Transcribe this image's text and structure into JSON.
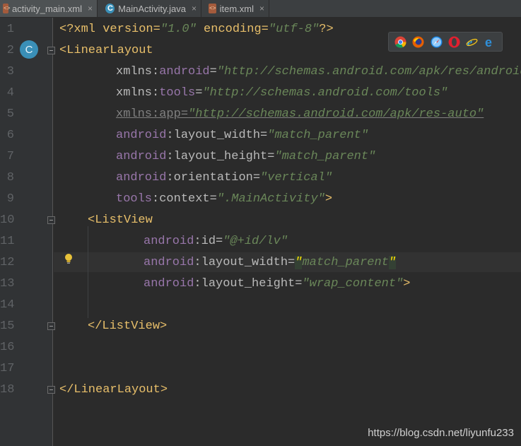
{
  "tabs": [
    {
      "label": "activity_main.xml",
      "icon": "xml-file-icon",
      "active": true
    },
    {
      "label": "MainActivity.java",
      "icon": "java-class-icon",
      "active": false
    },
    {
      "label": "item.xml",
      "icon": "xml-file-icon",
      "active": false
    }
  ],
  "close_glyph": "×",
  "badge": "C",
  "line_numbers": [
    "1",
    "2",
    "3",
    "4",
    "5",
    "6",
    "7",
    "8",
    "9",
    "10",
    "11",
    "12",
    "13",
    "14",
    "15",
    "16",
    "17",
    "18"
  ],
  "code": {
    "l1": {
      "open": "<?xml version=",
      "v1": "\"1.0\"",
      "mid": " encoding=",
      "v2": "\"utf-8\"",
      "close": "?>"
    },
    "l2": {
      "tag": "<LinearLayout"
    },
    "l3": {
      "attr": "xmlns:",
      "ns": "android",
      "eq": "=",
      "val": "\"http://schemas.android.com/apk/res/android\""
    },
    "l4": {
      "attr": "xmlns:",
      "ns": "tools",
      "eq": "=",
      "val": "\"http://schemas.android.com/tools\""
    },
    "l5": {
      "text": "xmlns:app=",
      "val": "\"http://schemas.android.com/apk/res-auto\""
    },
    "l6": {
      "ns": "android",
      "attr": ":layout_width=",
      "val": "\"match_parent\""
    },
    "l7": {
      "ns": "android",
      "attr": ":layout_height=",
      "val": "\"match_parent\""
    },
    "l8": {
      "ns": "android",
      "attr": ":orientation=",
      "val": "\"vertical\""
    },
    "l9": {
      "ns": "tools",
      "attr": ":context=",
      "val": "\".MainActivity\"",
      "close": ">"
    },
    "l10": {
      "tag": "<ListView"
    },
    "l11": {
      "ns": "android",
      "attr": ":id=",
      "val": "\"@+id/lv\""
    },
    "l12": {
      "ns": "android",
      "attr": ":layout_width=",
      "q1": "\"",
      "val": "match_parent",
      "q2": "\""
    },
    "l13": {
      "ns": "android",
      "attr": ":layout_height=",
      "val": "\"wrap_content\"",
      "close": ">"
    },
    "l15": {
      "tag": "</ListView>"
    },
    "l18": {
      "tag": "</LinearLayout>"
    }
  },
  "browsers": [
    "chrome-icon",
    "firefox-icon",
    "safari-icon",
    "opera-icon",
    "internet-explorer-icon",
    "edge-icon"
  ],
  "watermark": "https://blog.csdn.net/liyunfu233"
}
